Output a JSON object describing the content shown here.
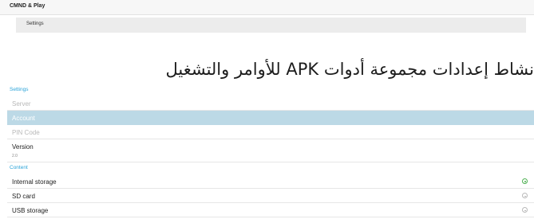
{
  "app": {
    "title": "CMND & Play"
  },
  "tabs": [
    {
      "label": "Settings"
    }
  ],
  "heading": "نشاط إعدادات مجموعة أدوات APK للأوامر والتشغيل",
  "settings_section": {
    "header": "Settings",
    "items": [
      {
        "label": "Server",
        "state": "disabled"
      },
      {
        "label": "Account",
        "state": "selected"
      },
      {
        "label": "PIN Code",
        "state": "disabled"
      },
      {
        "label": "Version",
        "value": "2.0",
        "state": "normal"
      }
    ]
  },
  "content_section": {
    "header": "Content",
    "items": [
      {
        "label": "Internal storage",
        "selected": true,
        "icon": "radio-checked-icon"
      },
      {
        "label": "SD card",
        "selected": false,
        "icon": "radio-unchecked-icon"
      },
      {
        "label": "USB storage",
        "selected": false,
        "icon": "radio-unchecked-icon"
      }
    ]
  },
  "colors": {
    "accent": "#2aa3d8",
    "selected_row": "#bcd9e6",
    "radio_on": "#4caf50",
    "disabled_text": "#b8b8b8"
  }
}
